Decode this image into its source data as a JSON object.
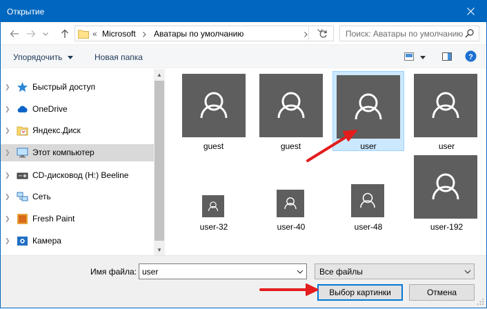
{
  "window": {
    "title": "Открытие"
  },
  "nav": {
    "back": "back",
    "forward": "forward",
    "history": "recent-locations",
    "up": "up"
  },
  "address": {
    "overflow": "«",
    "crumbs": [
      "Microsoft",
      "Аватары по умолчанию"
    ]
  },
  "search": {
    "placeholder": "Поиск: Аватары по умолчанию"
  },
  "toolbar": {
    "organize_label": "Упорядочить",
    "new_folder_label": "Новая папка"
  },
  "sidebar": {
    "items": [
      {
        "label": "Быстрый доступ",
        "icon": "star-icon"
      },
      {
        "label": "OneDrive",
        "icon": "cloud-icon"
      },
      {
        "label": "Яндекс.Диск",
        "icon": "yandex-disk-icon"
      },
      {
        "label": "Этот компьютер",
        "icon": "computer-icon",
        "selected": true
      },
      {
        "label": "CD-дисковод (H:) Beeline",
        "icon": "cd-drive-icon"
      },
      {
        "label": "Сеть",
        "icon": "network-icon"
      },
      {
        "label": "Fresh Paint",
        "icon": "fresh-paint-icon"
      },
      {
        "label": "Камера",
        "icon": "camera-icon"
      }
    ]
  },
  "files": [
    {
      "name": "guest"
    },
    {
      "name": "guest"
    },
    {
      "name": "user",
      "selected": true
    },
    {
      "name": "user"
    },
    {
      "name": "user-32"
    },
    {
      "name": "user-40"
    },
    {
      "name": "user-48"
    },
    {
      "name": "user-192"
    }
  ],
  "footer": {
    "filename_label": "Имя файла:",
    "filename_value": "user",
    "filter_value": "Все файлы",
    "open_label": "Выбор картинки",
    "cancel_label": "Отмена"
  },
  "colors": {
    "titlebar": "#0067c0",
    "annotation_arrow": "#e31c1c",
    "thumbnail": "#5e5e5e",
    "selection": "#cce8ff"
  }
}
